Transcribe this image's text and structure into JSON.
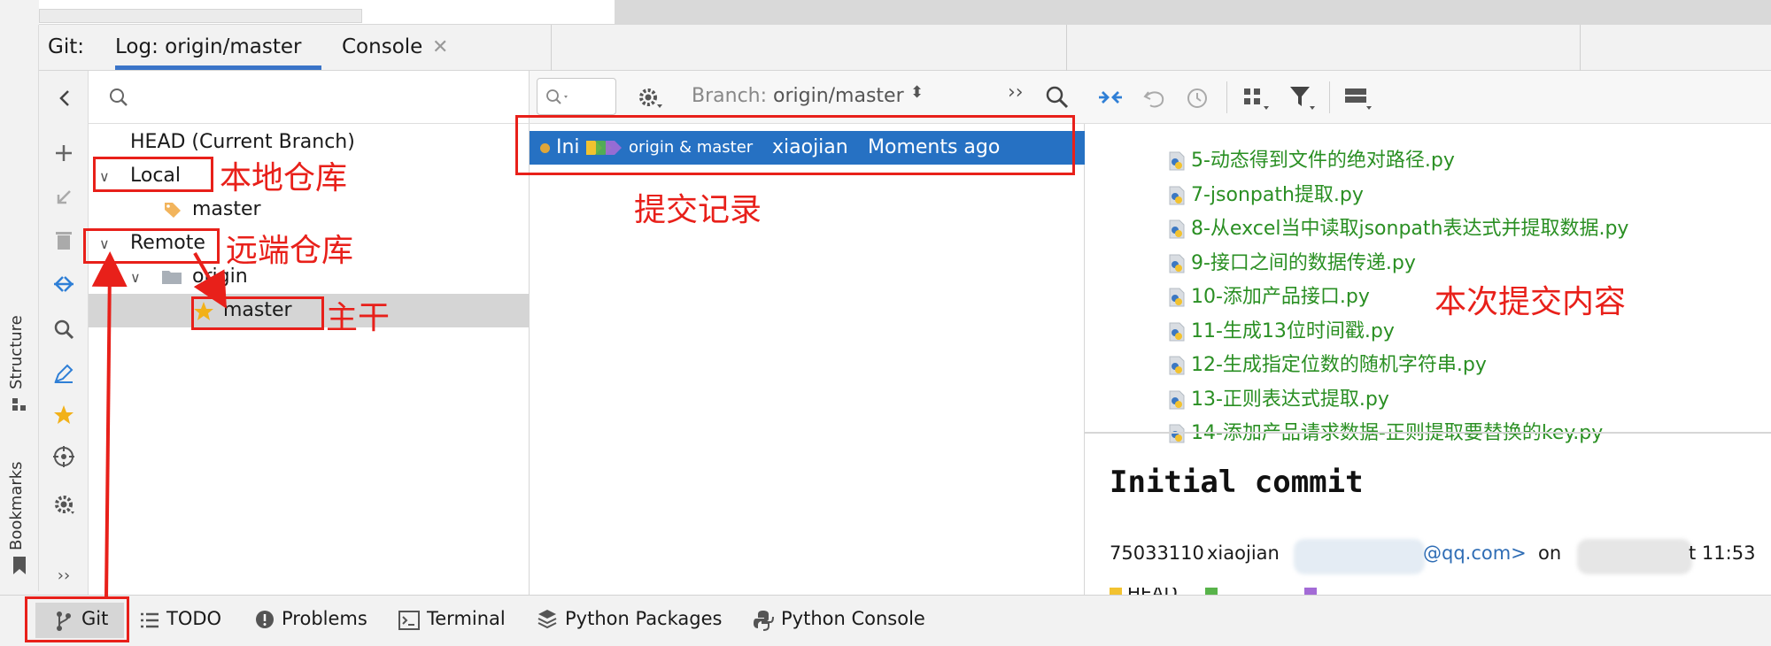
{
  "colors": {
    "accent": "#2671c3",
    "tab_underline": "#3a74c8",
    "annotation_red": "#e8201a",
    "file_green": "#2a8f23",
    "star_yellow": "#f2b118"
  },
  "left_stripe": {
    "structure": "Structure",
    "bookmarks": "Bookmarks"
  },
  "tabs": {
    "prefix": "Git:",
    "log": "Log: origin/master",
    "console": "Console"
  },
  "toolbar_icons": [
    "back-icon",
    "add-icon",
    "checkout-icon",
    "delete-icon",
    "fetch-icon",
    "search-icon",
    "edit-icon",
    "favorite-icon",
    "target-icon",
    "settings-icon",
    "expand-icon"
  ],
  "tree": {
    "head": "HEAD (Current Branch)",
    "local": "Local",
    "local_master": "master",
    "remote": "Remote",
    "origin": "origin",
    "remote_master": "master"
  },
  "log": {
    "branch_label": "Branch:",
    "branch_value": "origin/master",
    "commit": {
      "message_abbrev": "Ini",
      "refs": "origin & master",
      "author": "xiaojian",
      "time": "Moments ago"
    }
  },
  "details": {
    "files": [
      "5-动态得到文件的绝对路径.py",
      "7-jsonpath提取.py",
      "8-从excel当中读取jsonpath表达式并提取数据.py",
      "9-接口之间的数据传递.py",
      "10-添加产品接口.py",
      "11-生成13位时间戳.py",
      "12-生成指定位数的随机字符串.py",
      "13-正则表达式提取.py",
      "14-添加产品请求数据-正则提取要替换的key.py"
    ],
    "commit_title": "Initial commit",
    "hash": "75033110",
    "author": "xiaojian",
    "email_suffix": "@qq.com>",
    "on": "on",
    "time_suffix": "t 11:53",
    "refs_partial": "HEAD"
  },
  "bottom_bar": {
    "git": "Git",
    "todo": "TODO",
    "problems": "Problems",
    "terminal": "Terminal",
    "python_packages": "Python Packages",
    "python_console": "Python Console"
  },
  "annotations": {
    "local_repo": "本地仓库",
    "remote_repo": "远端仓库",
    "trunk": "主干",
    "commit_record": "提交记录",
    "commit_content": "本次提交内容"
  }
}
